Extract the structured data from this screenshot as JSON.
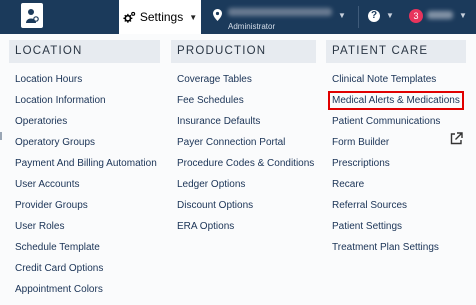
{
  "topbar": {
    "settings_label": "Settings",
    "location_role": "Administrator",
    "notification_count": "3",
    "colors": {
      "bar": "#1b3a5b",
      "badge": "#e8345c"
    }
  },
  "menu": {
    "location": {
      "header": "LOCATION",
      "items": [
        "Location Hours",
        "Location Information",
        "Operatories",
        "Operatory Groups",
        "Payment And Billing Automation",
        "User Accounts",
        "Provider Groups",
        "User Roles",
        "Schedule Template",
        "Credit Card Options",
        "Appointment Colors"
      ]
    },
    "production": {
      "header": "PRODUCTION",
      "items": [
        "Coverage Tables",
        "Fee Schedules",
        "Insurance Defaults",
        "Payer Connection Portal",
        "Procedure Codes & Conditions",
        "Ledger Options",
        "Discount Options",
        "ERA Options"
      ]
    },
    "patient_care": {
      "header": "PATIENT CARE",
      "items": [
        "Clinical Note Templates",
        "Medical Alerts & Medications",
        "Patient Communications",
        "Form Builder",
        "Prescriptions",
        "Recare",
        "Referral Sources",
        "Patient Settings",
        "Treatment Plan Settings"
      ]
    },
    "highlight_color": "#e00000"
  }
}
